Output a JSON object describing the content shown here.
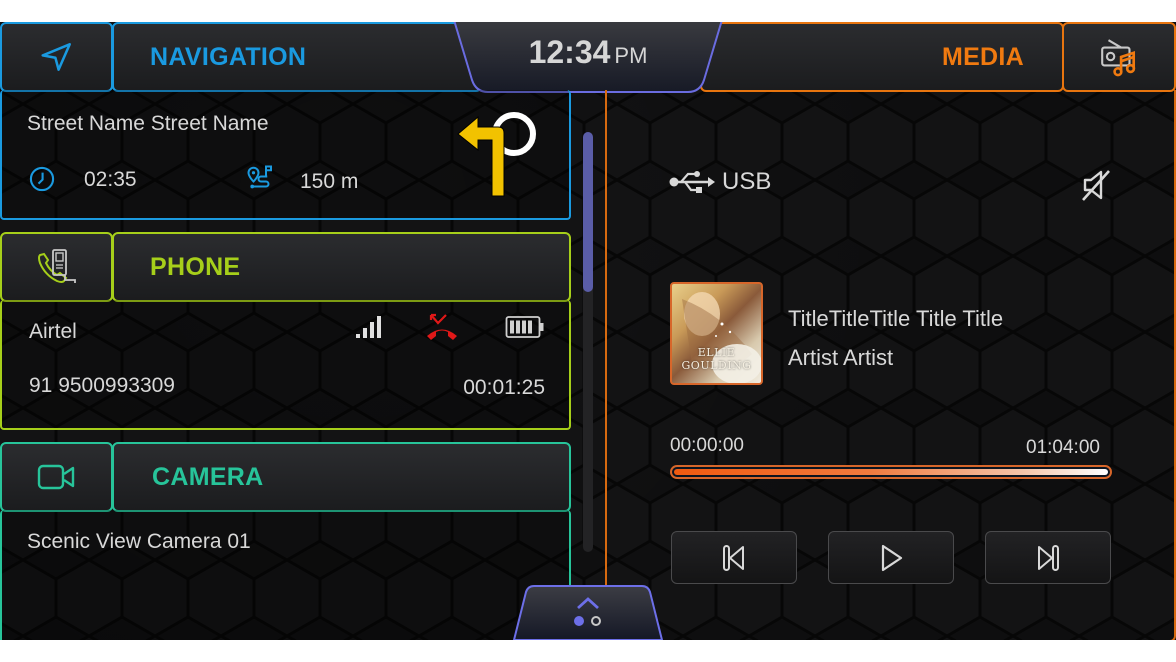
{
  "header": {
    "navigation": {
      "label": "NAVIGATION",
      "icon": "navigation-arrow-icon",
      "color": "#1a9ae0"
    },
    "clock": {
      "time": "12:34",
      "period": "PM"
    },
    "media": {
      "label": "MEDIA",
      "icon": "radio-music-icon",
      "color": "#f07a10"
    }
  },
  "navigation": {
    "street": "Street Name Street Name",
    "eta": "02:35",
    "eta_icon": "clock-icon",
    "distance": "150 m",
    "distance_icon": "route-icon",
    "turn_icon": "turn-left-roundabout-icon",
    "turn_color": "#f2c200"
  },
  "phone": {
    "label": "PHONE",
    "icon": "phone-device-icon",
    "color": "#a6cf1a",
    "carrier": "Airtel",
    "number": "91 9500993309",
    "duration": "00:01:25",
    "status_icons": [
      "signal-icon",
      "missed-call-icon",
      "battery-icon"
    ],
    "missed_call_color": "#e01818"
  },
  "camera": {
    "label": "CAMERA",
    "icon": "video-camera-icon",
    "color": "#27c49a",
    "name": "Scenic View Camera 01"
  },
  "media": {
    "source": "USB",
    "source_icon": "usb-icon",
    "mute_icon": "speaker-muted-icon",
    "album_art_text": "ELLIE GOULDING",
    "title": "TitleTitleTitle Title  Title",
    "artist": "Artist Artist",
    "elapsed": "00:00:00",
    "total": "01:04:00",
    "progress_percent": 100,
    "controls": [
      {
        "name": "previous-track",
        "icon": "skip-previous-icon"
      },
      {
        "name": "play",
        "icon": "play-icon"
      },
      {
        "name": "next-track",
        "icon": "skip-next-icon"
      }
    ]
  },
  "pager": {
    "icon": "chevron-up-icon",
    "pages": 2,
    "active_page": 1,
    "accent": "#6d6fe8"
  },
  "scroll": {
    "position_percent": 0
  }
}
